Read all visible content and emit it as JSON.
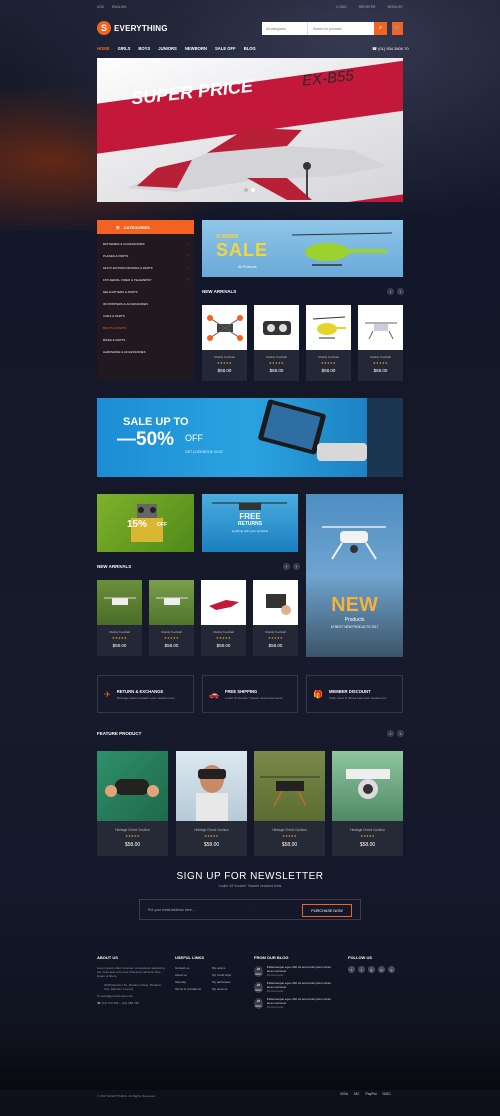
{
  "topbar": {
    "currency": "USD",
    "language": "ENGLISH",
    "account": "LOGIN",
    "register": "REGISTER",
    "wishlist": "WISHLIST"
  },
  "logo": {
    "mark": "S",
    "name": "EVERYTHING"
  },
  "search": {
    "category": "All categories",
    "placeholder": "Search for products",
    "icon": "search-icon"
  },
  "cart": {
    "icon": "cart-icon"
  },
  "nav": [
    "HOME",
    "GIRLS",
    "BOYS",
    "JUNIORS",
    "NEWBORN",
    "SALE OFF",
    "BLOG"
  ],
  "phone": "(01) 934 3400 70",
  "hero": {
    "title": "SUPER PRICE",
    "model": "EX-B55",
    "accent": "#c3183a"
  },
  "categories": {
    "title": "CATEGORIES",
    "items": [
      {
        "label": "BATTERIES & ACCESSORIES",
        "arrow": "›"
      },
      {
        "label": "PLANES & PARTS",
        "arrow": "›"
      },
      {
        "label": "MULTI-ROTORS DRONES & PARTS",
        "arrow": "›"
      },
      {
        "label": "FPV AERIAL VIDEO & TELEMETRY",
        "arrow": "›"
      },
      {
        "label": "HELICOPTERS & PARTS",
        "arrow": ""
      },
      {
        "label": "3D PRINTERS & ACCESSORIES",
        "arrow": ""
      },
      {
        "label": "CARS & PARTS",
        "arrow": ""
      },
      {
        "label": "BOATS & PARTS",
        "arrow": ""
      },
      {
        "label": "BIKES & PARTS",
        "arrow": ""
      },
      {
        "label": "HARDWARE & ACCESSORIES",
        "arrow": ""
      }
    ]
  },
  "sale_box": {
    "small": "SUMMER",
    "big": "SALE",
    "sub": "All Products"
  },
  "new_arrivals_1": {
    "title": "NEW ARRIVALS",
    "products": [
      {
        "name": "Muddy Football",
        "stars": "★★★★★",
        "price": "$58.00"
      },
      {
        "name": "Muddy Football",
        "stars": "★★★★★",
        "price": "$58.00"
      },
      {
        "name": "Muddy Football",
        "stars": "★★★★★",
        "price": "$58.00"
      },
      {
        "name": "Muddy Football",
        "stars": "★★★★★",
        "price": "$58.00"
      }
    ]
  },
  "banner": {
    "line1": "SALE UP TO",
    "line2": "—50%",
    "off": "OFF",
    "link": "GET LOOKBOOK 01/02"
  },
  "promo_tiles": {
    "percent": "15%",
    "percent_off": "OFF",
    "free": "FREE",
    "returns": "RETURNS",
    "returns_sub": "anything with your products",
    "big_new": "NEW",
    "big_products": "Products",
    "big_sub": "10 BEST NEW PRODUCTS 2017"
  },
  "new_arrivals_2": {
    "title": "NEW ARRIVALS",
    "products": [
      {
        "name": "Muddy Football",
        "stars": "★★★★★",
        "price": "$58.00"
      },
      {
        "name": "Muddy Football",
        "stars": "★★★★★",
        "price": "$58.00"
      },
      {
        "name": "Muddy Football",
        "stars": "★★★★★",
        "price": "$58.00"
      },
      {
        "name": "Muddy Football",
        "stars": "★★★★★",
        "price": "$58.00"
      }
    ]
  },
  "features": [
    {
      "icon": "plane-icon",
      "title": "RETURN & EXCHANGE",
      "sub": "Message jacket hardeki't elem leadset nunc"
    },
    {
      "icon": "car-icon",
      "title": "FREE SHIPPING",
      "sub": "Loqfer Al Sousbe' Yasaeit neversized leedo"
    },
    {
      "icon": "gift-icon",
      "title": "MEMBER DISCOUNT",
      "sub": "Pado Certo D dhesa Kelomast' leedset turn"
    }
  ],
  "feature_product": {
    "title": "FEATURE PRODUCT",
    "products": [
      {
        "name": "Heritage Check Cushion",
        "stars": "★★★★★",
        "price": "$58.00"
      },
      {
        "name": "Heritage Check Cushion",
        "stars": "★★★★★",
        "price": "$58.00"
      },
      {
        "name": "Heritage Check Cushion",
        "stars": "★★★★★",
        "price": "$58.00"
      },
      {
        "name": "Heritage Check Cushion",
        "stars": "★★★★★",
        "price": "$58.00"
      }
    ]
  },
  "newsletter": {
    "title": "SIGN UP FOR NEWSLETTER",
    "sub": "Loqfer All Sousbe' Yasaeit versized leets",
    "placeholder": "Put your email address here...",
    "button": "PURCHASE NOW"
  },
  "footer": {
    "about": {
      "title": "ABOUT US",
      "text": "Lorem ipsum dolor sit amet, consectetur adipiscing elit. Cras quis eros erat. Praesent vehicula risus ipsum ut libero.",
      "address": "2245 Random St., Random State, Random City, Random Country.",
      "email": "name@yourdomain.com",
      "phone": "(01) 372 456 – (01) 958 780"
    },
    "links": {
      "title": "USEFUL LINKS",
      "items": [
        "Contact us",
        "My orders",
        "About us",
        "My credit slips",
        "Sitemap",
        "My addresses",
        "Terms & Conditions",
        "My account"
      ]
    },
    "blog": {
      "title": "FROM OUR BLOG",
      "posts": [
        {
          "day": "28",
          "mon": "AUG",
          "text": "Pellentesque eget nibh sit amet felis ipsum dolor amet consecte",
          "comments": "29 Comments"
        },
        {
          "day": "28",
          "mon": "AUG",
          "text": "Pellentesque eget nibh sit amet felis ipsum dolor amet consecte",
          "comments": "29 Comments"
        },
        {
          "day": "28",
          "mon": "AUG",
          "text": "Pellentesque eget nibh sit amet felis ipsum dolor amet consecte",
          "comments": "29 Comments"
        }
      ]
    },
    "follow": {
      "title": "FOLLOW US",
      "icons": [
        "f",
        "t",
        "g",
        "in",
        "p"
      ]
    }
  },
  "copyright": "© 2017 EVERYTHING. All Rights Reserved.",
  "payments": [
    "VISA",
    "MC",
    "PayPal",
    "DISC"
  ],
  "colors": {
    "accent": "#f26322",
    "star": "#f5a623"
  }
}
